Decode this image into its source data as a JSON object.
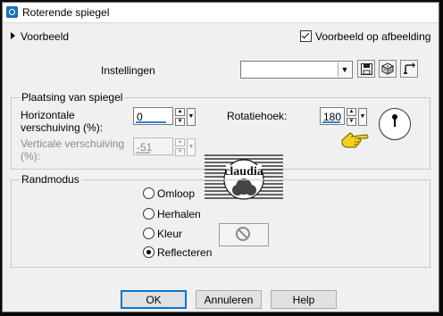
{
  "window": {
    "title": "Roterende spiegel"
  },
  "preview": {
    "toggle_label": "Voorbeeld",
    "on_image_label": "Voorbeeld op afbeelding",
    "on_image_checked": true
  },
  "presets": {
    "label": "Instellingen",
    "value": ""
  },
  "placement": {
    "title": "Plaatsing van spiegel",
    "horizontal_label_1": "Horizontale",
    "horizontal_label_2": "verschuiving (%):",
    "horizontal_value": "0",
    "vertical_label_1": "Verticale verschuiving",
    "vertical_label_2": "(%):",
    "vertical_value": "-51",
    "rotation_label": "Rotatiehoek:",
    "rotation_value": "180"
  },
  "edge_mode": {
    "title": "Randmodus",
    "options": [
      {
        "label": "Omloop",
        "checked": false
      },
      {
        "label": "Herhalen",
        "checked": false
      },
      {
        "label": "Kleur",
        "checked": false
      },
      {
        "label": "Reflecteren",
        "checked": true
      }
    ]
  },
  "watermark": {
    "text": "claudia"
  },
  "buttons": {
    "ok": "OK",
    "cancel": "Annuleren",
    "help": "Help"
  },
  "icons": {
    "app": "app-icon",
    "save_preset": "save-icon",
    "randomize": "dice-icon",
    "reset": "reset-arrow-icon",
    "pointer": "pointing-hand-icon",
    "no_color": "no-sign-icon",
    "angle_dial": "rotation-dial-icon"
  },
  "colors": {
    "accent": "#2f7fd6",
    "hand": "#f2d21a"
  }
}
